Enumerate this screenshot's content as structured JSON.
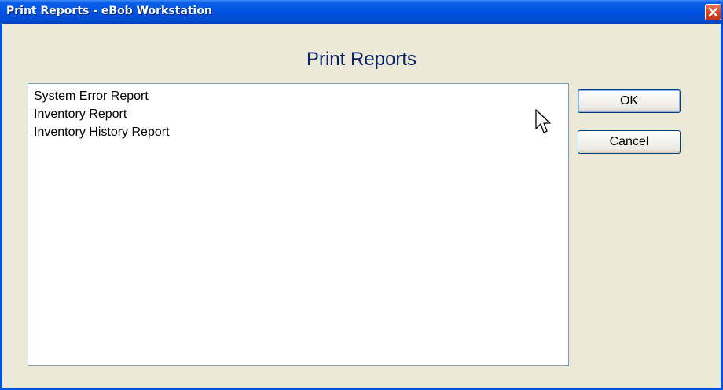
{
  "window": {
    "title": "Print Reports - eBob Workstation"
  },
  "titlebar": {
    "close_icon": "close-icon"
  },
  "dialog": {
    "heading": "Print Reports",
    "reports": [
      "System Error Report",
      "Inventory Report",
      "Inventory History Report"
    ]
  },
  "buttons": {
    "ok_label": "OK",
    "cancel_label": "Cancel"
  },
  "colors": {
    "titlebar_blue": "#0054e3",
    "dialog_background": "#ece9d8",
    "heading_color": "#0a246a",
    "close_red": "#d6452a"
  },
  "cursor": {
    "icon": "mouse-pointer-icon"
  }
}
